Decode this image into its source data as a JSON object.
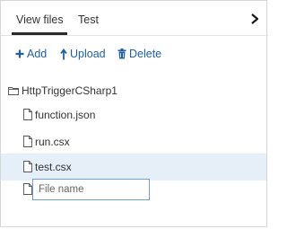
{
  "tabs": [
    {
      "label": "View files",
      "active": true
    },
    {
      "label": "Test",
      "active": false
    }
  ],
  "toolbar": {
    "add_label": "Add",
    "upload_label": "Upload",
    "delete_label": "Delete"
  },
  "tree": {
    "root": "HttpTriggerCSharp1",
    "files": [
      "function.json",
      "run.csx",
      "test.csx"
    ],
    "selected": "test.csx"
  },
  "new_file": {
    "placeholder": "File name",
    "value": ""
  },
  "colors": {
    "accent": "#1f5fa8",
    "selected_row": "#e6eef8",
    "input_border": "#6fa1d9"
  },
  "icons": [
    "chevron-right-icon",
    "plus-icon",
    "upload-icon",
    "trash-icon",
    "folder-icon",
    "file-icon"
  ]
}
